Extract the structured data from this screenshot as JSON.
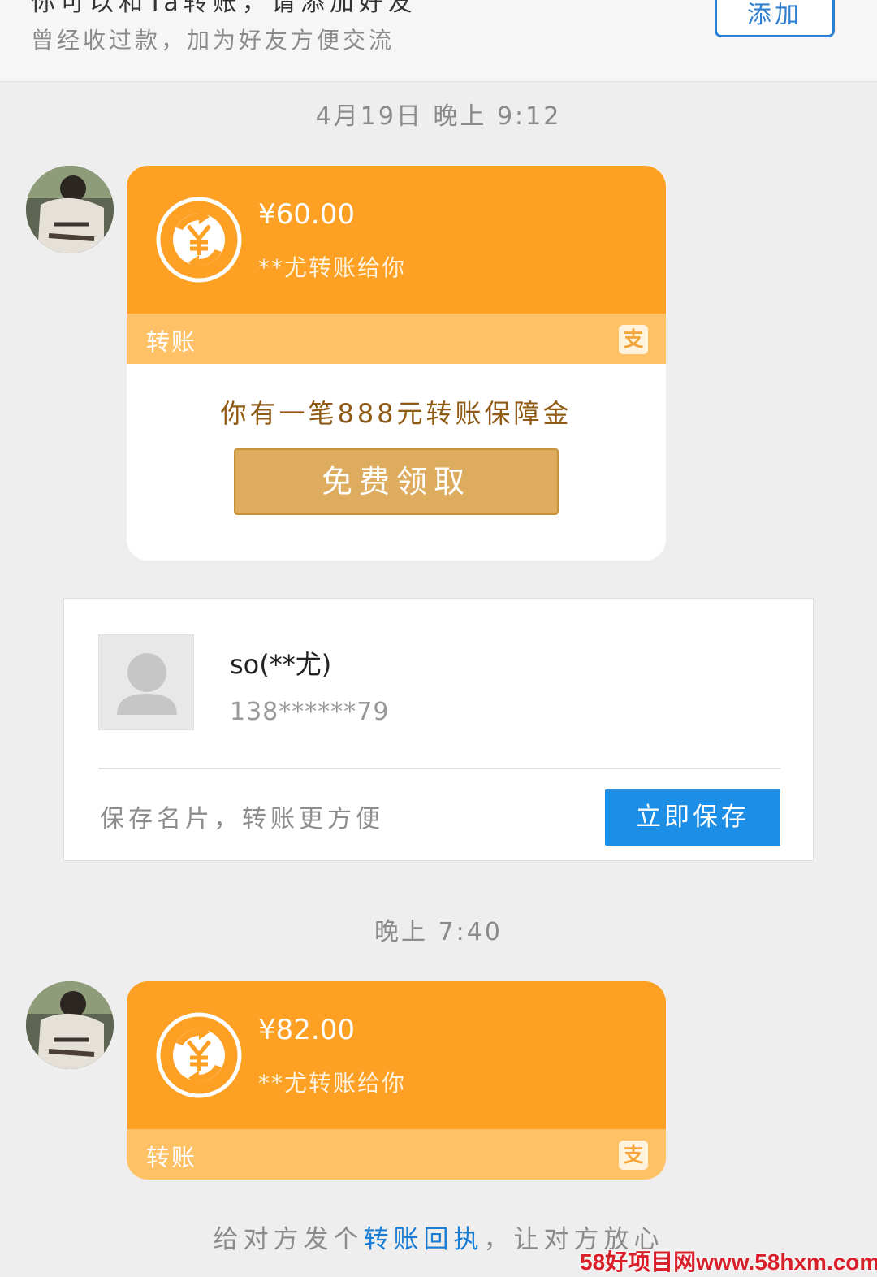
{
  "header": {
    "cut_title": "你可以和Ta转账，请添加好友",
    "subtitle": "曾经收过款，加为好友方便交流",
    "add_label": "添加"
  },
  "messages": [
    {
      "time": "4月19日 晚上 9:12",
      "amount": "¥60.00",
      "from_text": "**尤转账给你",
      "strip_label": "转账",
      "badge": "支",
      "bonus_text": "你有一笔888元转账保障金",
      "claim_label": "免费领取"
    },
    {
      "time": "晚上 7:40",
      "amount": "¥82.00",
      "from_text": "**尤转账给你",
      "strip_label": "转账",
      "badge": "支"
    }
  ],
  "contact": {
    "name": "so(**尤)",
    "phone": "138******79",
    "save_tip": "保存名片，转账更方便",
    "save_label": "立即保存"
  },
  "receipt": {
    "prefix": "给对方发个",
    "link": "转账回执",
    "suffix": "，让对方放心"
  },
  "watermark": "58好项目网www.58hxm.com",
  "colors": {
    "card_orange": "#fda024",
    "strip_orange": "#ffc166",
    "link_blue": "#1b7ed6",
    "button_blue": "#1c8ee6",
    "claim_gold": "#deac5f"
  }
}
